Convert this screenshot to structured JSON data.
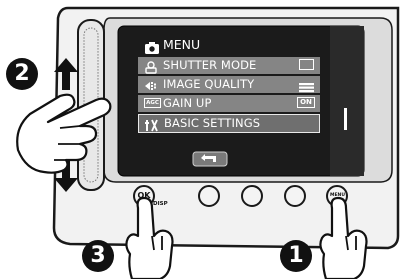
{
  "menu": {
    "title": "MENU",
    "items": [
      {
        "label": "SHUTTER MODE",
        "icon": "shutter-mode-icon",
        "value_icon": "shutter-option-icon"
      },
      {
        "label": "IMAGE QUALITY",
        "icon": "image-quality-icon",
        "value_icon": "quality-bars-icon"
      },
      {
        "label": "GAIN UP",
        "icon": "agc-icon",
        "icon_text": "AGC",
        "value_text": "ON"
      },
      {
        "label": "BASIC SETTINGS",
        "icon": "basic-settings-icon",
        "selected": true
      }
    ],
    "back_icon": "return-arrow-icon"
  },
  "buttons": {
    "ok_label": "OK",
    "disp_label": "DISP",
    "menu_label": "MENU"
  },
  "steps": {
    "one": "1",
    "two": "2",
    "three": "3"
  },
  "colors": {
    "lcd_bg": "#1b1b1b",
    "row_bg": "#8a8a8a",
    "selected_row": "#6f6f6f",
    "accent": "#bdbdbd"
  }
}
